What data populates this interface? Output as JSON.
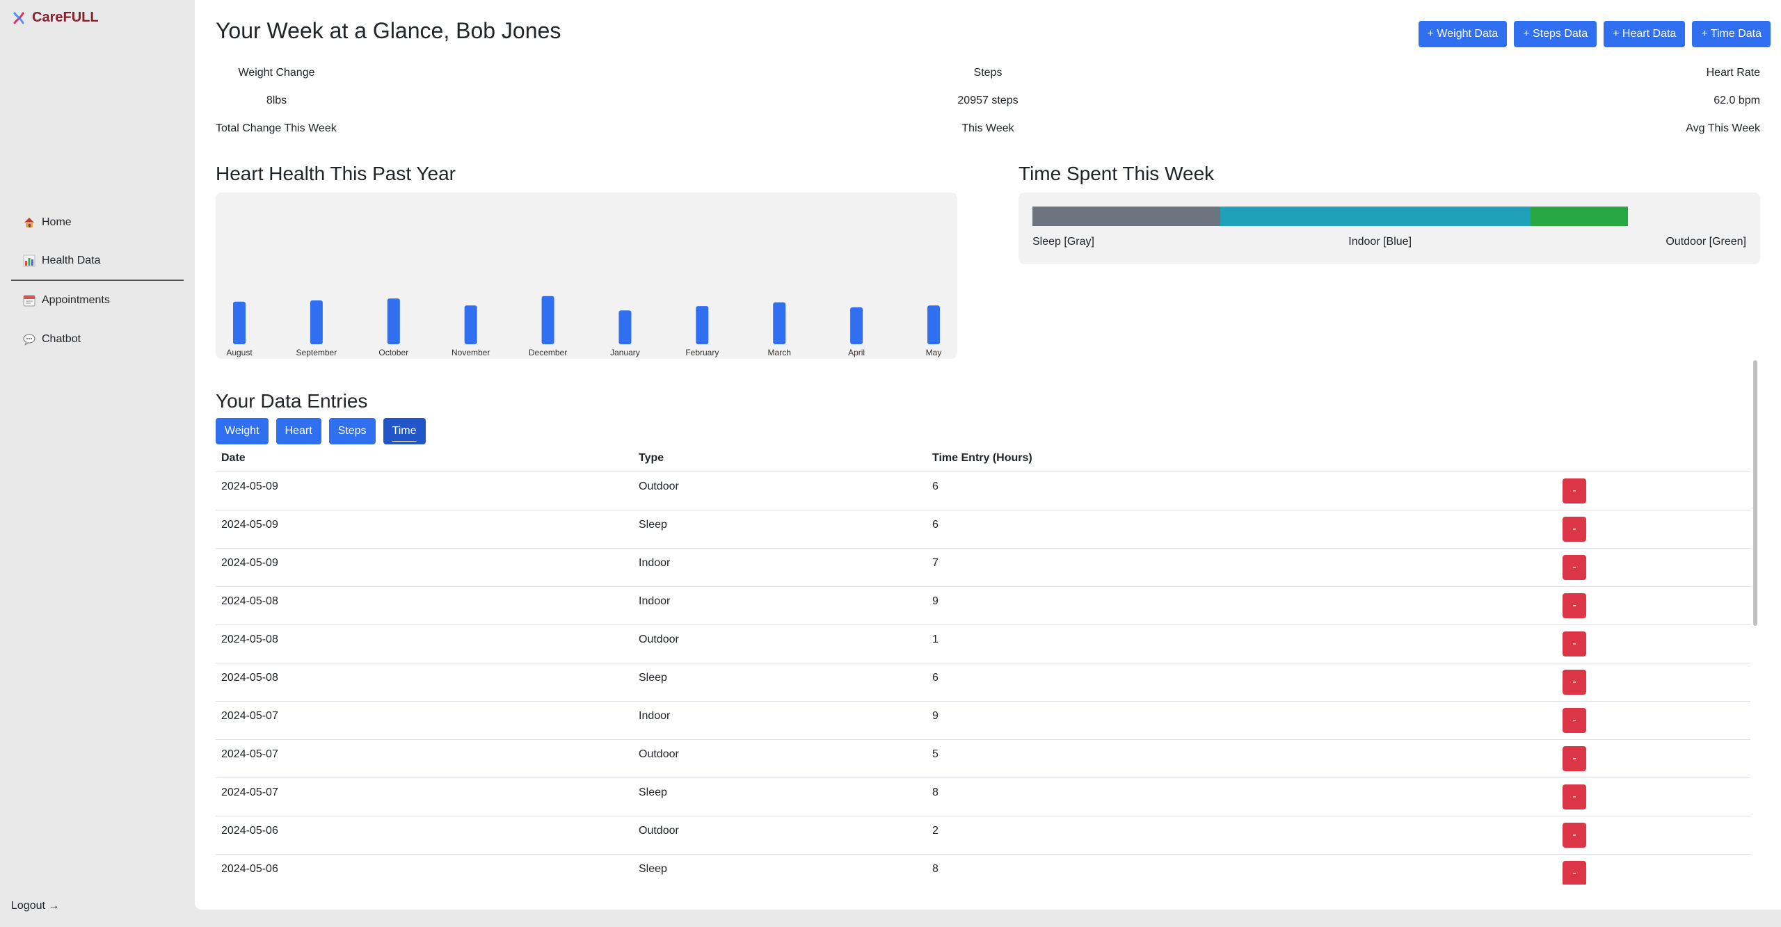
{
  "app": {
    "name": "CareFULL"
  },
  "nav": {
    "items": [
      {
        "label": "Home",
        "icon": "house-icon"
      },
      {
        "label": "Health Data",
        "icon": "bar-chart-icon"
      },
      {
        "label": "Appointments",
        "icon": "calendar-icon"
      },
      {
        "label": "Chatbot",
        "icon": "speech-bubble-icon"
      }
    ],
    "active": "Health Data",
    "logout_label": "Logout →"
  },
  "header": {
    "title": "Your Week at a Glance, Bob Jones",
    "buttons": [
      "+ Weight Data",
      "+ Steps Data",
      "+ Heart Data",
      "+ Time Data"
    ]
  },
  "stats": {
    "weight": {
      "label": "Weight Change",
      "value": "8lbs",
      "sub": "Total Change This Week"
    },
    "steps": {
      "label": "Steps",
      "value": "20957 steps",
      "sub": "This Week"
    },
    "heart": {
      "label": "Heart Rate",
      "value": "62.0 bpm",
      "sub": "Avg This Week"
    }
  },
  "heart_section": {
    "title": "Heart Health This Past Year"
  },
  "chart_data": {
    "type": "bar",
    "categories": [
      "August",
      "September",
      "October",
      "November",
      "December",
      "January",
      "February",
      "March",
      "April",
      "May"
    ],
    "values": [
      68,
      70,
      73,
      62,
      77,
      54,
      61,
      67,
      59,
      62
    ],
    "ylim": [
      0,
      100
    ],
    "color": "#2f6ff0",
    "grid": false
  },
  "time_section": {
    "title": "Time Spent This Week",
    "segments": [
      {
        "label": "Sleep [Gray]",
        "fraction": 0.315,
        "color": "#6c757d"
      },
      {
        "label": "Indoor [Blue]",
        "fraction": 0.522,
        "color": "#20a1b9"
      },
      {
        "label": "Outdoor [Green]",
        "fraction": 0.163,
        "color": "#28a745"
      }
    ]
  },
  "entries": {
    "title": "Your Data Entries",
    "tabs": [
      "Weight",
      "Heart",
      "Steps",
      "Time"
    ],
    "active_tab": "Time",
    "columns": [
      "Date",
      "Type",
      "Time Entry (Hours)"
    ],
    "delete_label": "-",
    "rows": [
      [
        "2024-05-09",
        "Outdoor",
        "6"
      ],
      [
        "2024-05-09",
        "Sleep",
        "6"
      ],
      [
        "2024-05-09",
        "Indoor",
        "7"
      ],
      [
        "2024-05-08",
        "Indoor",
        "9"
      ],
      [
        "2024-05-08",
        "Outdoor",
        "1"
      ],
      [
        "2024-05-08",
        "Sleep",
        "6"
      ],
      [
        "2024-05-07",
        "Indoor",
        "9"
      ],
      [
        "2024-05-07",
        "Outdoor",
        "5"
      ],
      [
        "2024-05-07",
        "Sleep",
        "8"
      ],
      [
        "2024-05-06",
        "Outdoor",
        "2"
      ],
      [
        "2024-05-06",
        "Sleep",
        "8"
      ]
    ]
  }
}
